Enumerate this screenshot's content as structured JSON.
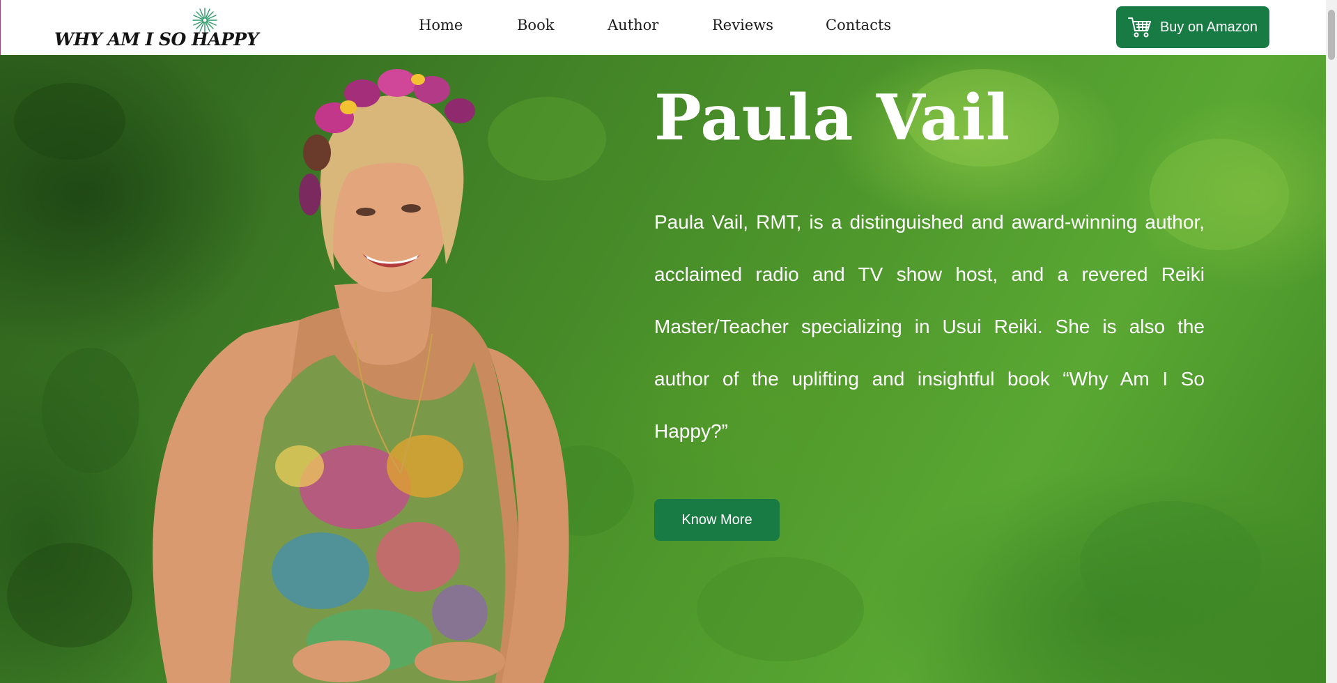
{
  "header": {
    "logo_text": "WHY AM I SO HAPPY",
    "nav": [
      {
        "label": "Home"
      },
      {
        "label": "Book"
      },
      {
        "label": "Author"
      },
      {
        "label": "Reviews"
      },
      {
        "label": "Contacts"
      }
    ],
    "cta_label": "Buy on Amazon",
    "cta_icon": "shopping-cart-icon"
  },
  "hero": {
    "title": "Paula Vail",
    "description": "Paula Vail, RMT, is a distinguished and award-winning author, acclaimed radio and TV show host, and a revered Reiki Master/Teacher specializing in Usui Reiki. She is also the author of the uplifting and insightful book “Why Am I So Happy?”",
    "button_label": "Know More"
  },
  "colors": {
    "brand_green": "#187b43",
    "header_bg": "#ffffff",
    "hero_text": "#ffffff",
    "logo_burst": "#2e9a6a"
  }
}
